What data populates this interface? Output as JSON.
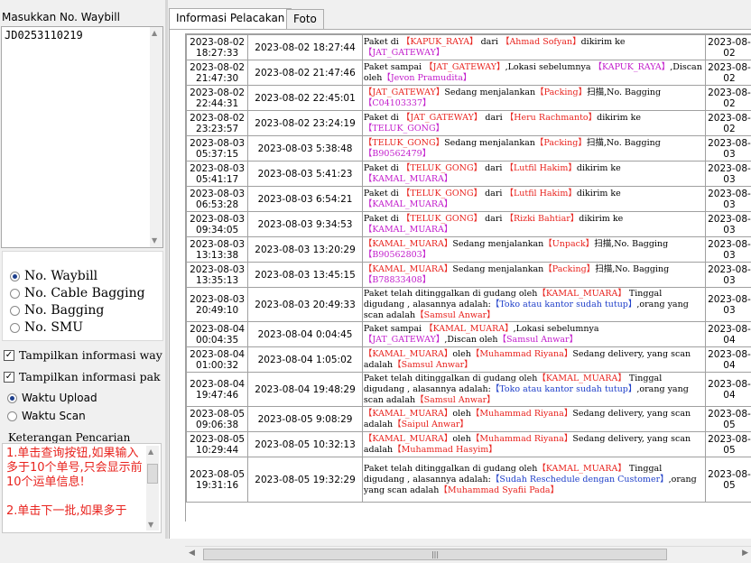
{
  "left": {
    "input_label": "Masukkan No. Waybill",
    "waybill_value": "JD0253110219",
    "search_types": [
      {
        "label": "No. Waybill",
        "selected": true
      },
      {
        "label": "No. Cable Bagging",
        "selected": false
      },
      {
        "label": "No. Bagging",
        "selected": false
      },
      {
        "label": "No. SMU",
        "selected": false
      }
    ],
    "checkboxes": [
      {
        "label": "Tampilkan informasi way",
        "checked": true
      },
      {
        "label": "Tampilkan informasi pak",
        "checked": true
      }
    ],
    "time_options": [
      {
        "label": "Waktu Upload",
        "selected": true
      },
      {
        "label": "Waktu Scan",
        "selected": false
      }
    ],
    "search_info_title": "Keterangan Pencarian",
    "search_info_text": "1.单击查询按钮,如果输入多于10个单号,只会显示前10个运单信息!\n\n2.单击下一批,如果多于"
  },
  "tabs": [
    {
      "label": "Informasi Pelacakan",
      "active": true
    },
    {
      "label": "Foto",
      "active": false
    }
  ],
  "rows": [
    {
      "t1": "2023-08-02 18:27:33",
      "t2": "2023-08-02 18:27:44",
      "desc": [
        {
          "t": "Paket di ",
          "c": ""
        },
        {
          "t": "【KAPUK_RAYA】",
          "c": "hl"
        },
        {
          "t": " dari ",
          "c": ""
        },
        {
          "t": "【Ahmad Sofyan】",
          "c": "hl"
        },
        {
          "t": "dikirim ke ",
          "c": ""
        },
        {
          "t": "【JAT_GATEWAY】",
          "c": "pk"
        }
      ],
      "d": "2023-08-02"
    },
    {
      "t1": "2023-08-02 21:47:30",
      "t2": "2023-08-02 21:47:46",
      "desc": [
        {
          "t": "Paket sampai ",
          "c": ""
        },
        {
          "t": "【JAT_GATEWAY】",
          "c": "hl"
        },
        {
          "t": ",Lokasi sebelumnya ",
          "c": ""
        },
        {
          "t": "【KAPUK_RAYA】",
          "c": "pk"
        },
        {
          "t": ",Discan oleh",
          "c": ""
        },
        {
          "t": "【Jevon Pramudita】",
          "c": "pk"
        }
      ],
      "d": "2023-08-02"
    },
    {
      "t1": "2023-08-02 22:44:31",
      "t2": "2023-08-02 22:45:01",
      "desc": [
        {
          "t": "【JAT_GATEWAY】",
          "c": "hl"
        },
        {
          "t": "Sedang menjalankan",
          "c": ""
        },
        {
          "t": "【Packing】",
          "c": "hl"
        },
        {
          "t": "扫描,No. Bagging",
          "c": ""
        },
        {
          "t": "【C04103337】",
          "c": "pk"
        }
      ],
      "d": "2023-08-02"
    },
    {
      "t1": "2023-08-02 23:23:57",
      "t2": "2023-08-02 23:24:19",
      "desc": [
        {
          "t": "Paket di ",
          "c": ""
        },
        {
          "t": "【JAT_GATEWAY】",
          "c": "hl"
        },
        {
          "t": " dari ",
          "c": ""
        },
        {
          "t": "【Heru Rachmanto】",
          "c": "hl"
        },
        {
          "t": "dikirim ke ",
          "c": ""
        },
        {
          "t": "【TELUK_GONG】",
          "c": "pk"
        }
      ],
      "d": "2023-08-02"
    },
    {
      "t1": "2023-08-03 05:37:15",
      "t2": "2023-08-03 5:38:48",
      "desc": [
        {
          "t": "【TELUK_GONG】",
          "c": "hl"
        },
        {
          "t": "Sedang menjalankan",
          "c": ""
        },
        {
          "t": "【Packing】",
          "c": "hl"
        },
        {
          "t": "扫描,No. Bagging",
          "c": ""
        },
        {
          "t": "【B90562479】",
          "c": "pk"
        }
      ],
      "d": "2023-08-03"
    },
    {
      "t1": "2023-08-03 05:41:17",
      "t2": "2023-08-03 5:41:23",
      "desc": [
        {
          "t": "Paket di ",
          "c": ""
        },
        {
          "t": "【TELUK_GONG】",
          "c": "hl"
        },
        {
          "t": " dari ",
          "c": ""
        },
        {
          "t": "【Lutfil Hakim】",
          "c": "hl"
        },
        {
          "t": "dikirim ke ",
          "c": ""
        },
        {
          "t": "【KAMAL_MUARA】",
          "c": "pk"
        }
      ],
      "d": "2023-08-03"
    },
    {
      "t1": "2023-08-03 06:53:28",
      "t2": "2023-08-03 6:54:21",
      "desc": [
        {
          "t": "Paket di ",
          "c": ""
        },
        {
          "t": "【TELUK_GONG】",
          "c": "hl"
        },
        {
          "t": " dari ",
          "c": ""
        },
        {
          "t": "【Lutfil Hakim】",
          "c": "hl"
        },
        {
          "t": "dikirim ke ",
          "c": ""
        },
        {
          "t": "【KAMAL_MUARA】",
          "c": "pk"
        }
      ],
      "d": "2023-08-03"
    },
    {
      "t1": "2023-08-03 09:34:05",
      "t2": "2023-08-03 9:34:53",
      "desc": [
        {
          "t": "Paket di ",
          "c": ""
        },
        {
          "t": "【TELUK_GONG】",
          "c": "hl"
        },
        {
          "t": " dari ",
          "c": ""
        },
        {
          "t": "【Rizki Bahtiar】",
          "c": "hl"
        },
        {
          "t": "dikirim ke ",
          "c": ""
        },
        {
          "t": "【KAMAL_MUARA】",
          "c": "pk"
        }
      ],
      "d": "2023-08-03"
    },
    {
      "t1": "2023-08-03 13:13:38",
      "t2": "2023-08-03 13:20:29",
      "desc": [
        {
          "t": "【KAMAL_MUARA】",
          "c": "hl"
        },
        {
          "t": "Sedang menjalankan",
          "c": ""
        },
        {
          "t": "【Unpack】",
          "c": "hl"
        },
        {
          "t": "扫描,No. Bagging",
          "c": ""
        },
        {
          "t": "【B90562803】",
          "c": "pk"
        }
      ],
      "d": "2023-08-03"
    },
    {
      "t1": "2023-08-03 13:35:13",
      "t2": "2023-08-03 13:45:15",
      "desc": [
        {
          "t": "【KAMAL_MUARA】",
          "c": "hl"
        },
        {
          "t": "Sedang menjalankan",
          "c": ""
        },
        {
          "t": "【Packing】",
          "c": "hl"
        },
        {
          "t": "扫描,No. Bagging",
          "c": ""
        },
        {
          "t": "【B78833408】",
          "c": "pk"
        }
      ],
      "d": "2023-08-03"
    },
    {
      "t1": "2023-08-03 20:49:10",
      "t2": "2023-08-03 20:49:33",
      "desc": [
        {
          "t": "Paket telah ditinggalkan di gudang oleh",
          "c": ""
        },
        {
          "t": "【KAMAL_MUARA】",
          "c": "hl"
        },
        {
          "t": " Tinggal digudang , alasannya adalah:",
          "c": ""
        },
        {
          "t": "【Toko atau kantor sudah tutup】",
          "c": "bl"
        },
        {
          "t": ",orang yang scan adalah",
          "c": ""
        },
        {
          "t": "【Samsul Anwar】",
          "c": "hl"
        }
      ],
      "d": "2023-08-03"
    },
    {
      "t1": "2023-08-04 00:04:35",
      "t2": "2023-08-04 0:04:45",
      "desc": [
        {
          "t": "Paket sampai ",
          "c": ""
        },
        {
          "t": "【KAMAL_MUARA】",
          "c": "hl"
        },
        {
          "t": ",Lokasi sebelumnya ",
          "c": ""
        },
        {
          "t": "【JAT_GATEWAY】",
          "c": "pk"
        },
        {
          "t": ",Discan oleh",
          "c": ""
        },
        {
          "t": "【Samsul Anwar】",
          "c": "pk"
        }
      ],
      "d": "2023-08-04"
    },
    {
      "t1": "2023-08-04 01:00:32",
      "t2": "2023-08-04 1:05:02",
      "desc": [
        {
          "t": "【KAMAL_MUARA】",
          "c": "hl"
        },
        {
          "t": "oleh",
          "c": ""
        },
        {
          "t": "【Muhammad Riyana】",
          "c": "hl"
        },
        {
          "t": "Sedang delivery, yang scan adalah",
          "c": ""
        },
        {
          "t": "【Samsul Anwar】",
          "c": "hl"
        }
      ],
      "d": "2023-08-04"
    },
    {
      "t1": "2023-08-04 19:47:46",
      "t2": "2023-08-04 19:48:29",
      "desc": [
        {
          "t": "Paket telah ditinggalkan di gudang oleh",
          "c": ""
        },
        {
          "t": "【KAMAL_MUARA】",
          "c": "hl"
        },
        {
          "t": " Tinggal digudang , alasannya adalah:",
          "c": ""
        },
        {
          "t": "【Toko atau kantor sudah tutup】",
          "c": "bl"
        },
        {
          "t": ",orang yang scan adalah",
          "c": ""
        },
        {
          "t": "【Samsul Anwar】",
          "c": "hl"
        }
      ],
      "d": "2023-08-04"
    },
    {
      "t1": "2023-08-05 09:06:38",
      "t2": "2023-08-05 9:08:29",
      "desc": [
        {
          "t": "【KAMAL_MUARA】",
          "c": "hl"
        },
        {
          "t": "oleh",
          "c": ""
        },
        {
          "t": "【Muhammad Riyana】",
          "c": "hl"
        },
        {
          "t": "Sedang delivery, yang scan adalah",
          "c": ""
        },
        {
          "t": "【Saipul Anwar】",
          "c": "hl"
        }
      ],
      "d": "2023-08-05"
    },
    {
      "t1": "2023-08-05 10:29:44",
      "t2": "2023-08-05 10:32:13",
      "desc": [
        {
          "t": "【KAMAL_MUARA】",
          "c": "hl"
        },
        {
          "t": "oleh",
          "c": ""
        },
        {
          "t": "【Muhammad Riyana】",
          "c": "hl"
        },
        {
          "t": "Sedang delivery, yang scan adalah",
          "c": ""
        },
        {
          "t": "【Muhammad Hasyim】",
          "c": "hl"
        }
      ],
      "d": "2023-08-05"
    },
    {
      "t1": "2023-08-05 19:31:16",
      "t2": "2023-08-05 19:32:29",
      "desc": [
        {
          "t": "Paket telah ditinggalkan di gudang oleh",
          "c": ""
        },
        {
          "t": "【KAMAL_MUARA】",
          "c": "hl"
        },
        {
          "t": " Tinggal digudang , alasannya adalah:",
          "c": ""
        },
        {
          "t": "【Sudah Reschedule dengan Customer】",
          "c": "bl"
        },
        {
          "t": ",orang yang scan adalah",
          "c": ""
        },
        {
          "t": "【Muhammad Syafii Pada】",
          "c": "hl"
        }
      ],
      "d": "2023-08-05"
    }
  ],
  "colors": {
    "highlight": "#e8231e",
    "pink": "#c21ccb",
    "blue": "#1f3fc9"
  },
  "icons": {
    "scroll_up": "arrow-up-icon",
    "scroll_down": "arrow-down-icon",
    "scroll_left": "arrow-left-icon",
    "scroll_right": "arrow-right-icon",
    "grip": "grip-icon"
  }
}
